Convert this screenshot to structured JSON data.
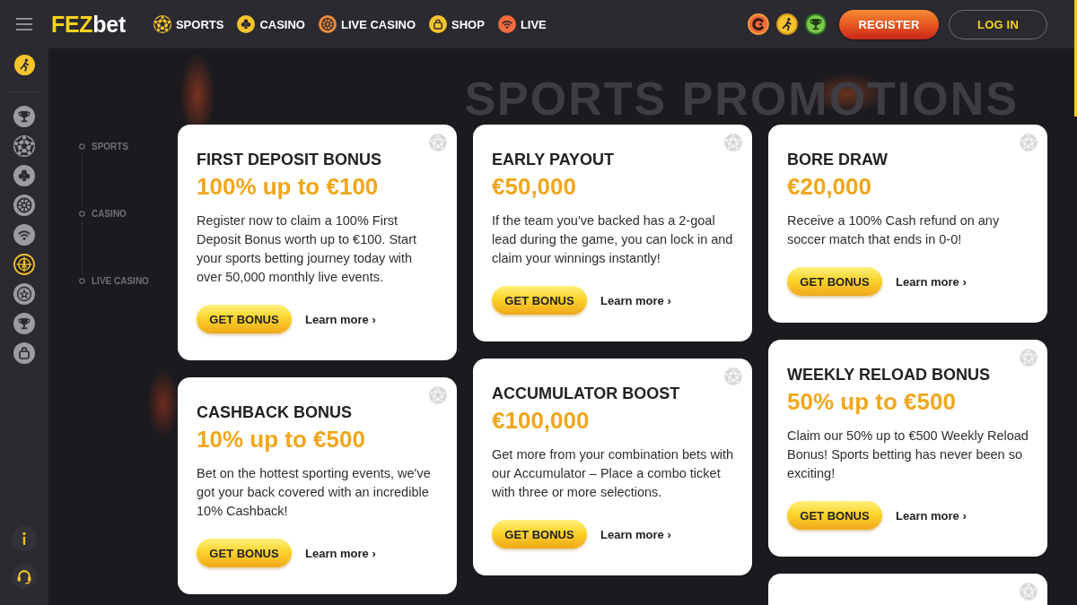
{
  "topbar": {
    "logo": {
      "prefix": "FEZ",
      "suffix": "bet"
    },
    "nav": [
      {
        "label": "SPORTS"
      },
      {
        "label": "CASINO"
      },
      {
        "label": "LIVE CASINO"
      },
      {
        "label": "SHOP"
      },
      {
        "label": "LIVE"
      }
    ],
    "buttons": [
      {
        "kind": "register",
        "label": "REGISTER"
      },
      {
        "kind": "login",
        "label": "LOG IN"
      }
    ]
  },
  "sidebar": {
    "items": [
      {
        "selected": false
      },
      {
        "selected": false
      },
      {
        "selected": false
      },
      {
        "selected": false
      },
      {
        "selected": false
      },
      {
        "selected": true
      },
      {
        "selected": false
      },
      {
        "selected": false
      },
      {
        "selected": false
      }
    ]
  },
  "subnav": [
    {
      "label": "SPORTS"
    },
    {
      "label": "CASINO"
    },
    {
      "label": "LIVE CASINO"
    }
  ],
  "page_title": "SPORTS PROMOTIONS",
  "columns": [
    {
      "cards": [
        {
          "kind": "full",
          "title": "FIRST DEPOSIT BONUS",
          "amount": "100% up to €100",
          "text": "Register now to claim a 100% First Deposit Bonus worth up to €100. Start your sports betting journey today with over 50,000 monthly live events.",
          "button": "GET BONUS",
          "link": "Learn more ›"
        },
        {
          "kind": "full",
          "title": "CASHBACK BONUS",
          "amount": "10% up to €500",
          "text": "Bet on the hottest sporting events, we've got your back covered with an incredible 10% Cashback!",
          "button": "GET BONUS",
          "link": "Learn more ›"
        }
      ]
    },
    {
      "cards": [
        {
          "kind": "full",
          "title": "EARLY PAYOUT",
          "amount": "€50,000",
          "text": "If the team you've backed has a 2-goal lead during the game, you can lock in and claim your winnings instantly!",
          "button": "GET BONUS",
          "link": "Learn more ›"
        },
        {
          "kind": "full",
          "title": "ACCUMULATOR BOOST",
          "amount": "€100,000",
          "text": "Get more from your combination bets with our Accumulator – Place a combo ticket with three or more selections.",
          "button": "GET BONUS",
          "link": "Learn more ›"
        }
      ]
    },
    {
      "cards": [
        {
          "kind": "full",
          "title": "BORE DRAW",
          "amount": "€20,000",
          "text": "Receive a 100% Cash refund on any soccer match that ends in 0-0!",
          "button": "GET BONUS",
          "link": "Learn more ›"
        },
        {
          "kind": "full",
          "title": "WEEKLY RELOAD BONUS",
          "amount": "50% up to €500",
          "text": "Claim our 50% up to €500 Weekly Reload Bonus! Sports betting has never been so exciting!",
          "button": "GET BONUS",
          "link": "Learn more ›"
        },
        {
          "kind": "cut"
        }
      ]
    }
  ]
}
